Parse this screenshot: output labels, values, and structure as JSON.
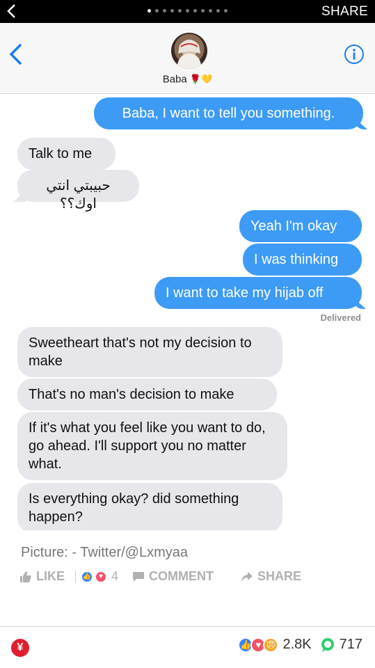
{
  "topbar": {
    "share_label": "SHARE",
    "page_dots": 11,
    "active_dot": 0
  },
  "conversation": {
    "contact_name": "Baba",
    "contact_emoji": "🌹💛"
  },
  "messages": [
    {
      "from": "me",
      "text": "Baba, I want to tell you something."
    },
    {
      "from": "them",
      "text": "Talk to me"
    },
    {
      "from": "them",
      "text": "حبيبتي انتي اوك؟؟"
    },
    {
      "from": "me",
      "text": "Yeah I'm okay"
    },
    {
      "from": "me",
      "text": "I was thinking"
    },
    {
      "from": "me",
      "text": "I want to take my hijab off"
    },
    {
      "from": "them",
      "text": "Sweetheart that's not my decision to make"
    },
    {
      "from": "them",
      "text": "That's no man's decision to make"
    },
    {
      "from": "them",
      "text": "If it's what you feel like you want to do, go ahead. I'll support you no matter what."
    },
    {
      "from": "them",
      "text": "Is everything okay? did something happen?"
    }
  ],
  "status": {
    "delivered": "Delivered"
  },
  "post": {
    "caption": "Picture: - Twitter/@Lxmyaa",
    "like_label": "LIKE",
    "reaction_count": "4",
    "comment_label": "COMMENT",
    "share_label": "SHARE"
  },
  "footer": {
    "reactions_total": "2.8K",
    "comments_total": "717"
  },
  "colors": {
    "outgoing": "#3d9bf5",
    "incoming": "#e6e6eb",
    "ios_blue": "#1a7cf5",
    "brand_red": "#e0202f"
  }
}
